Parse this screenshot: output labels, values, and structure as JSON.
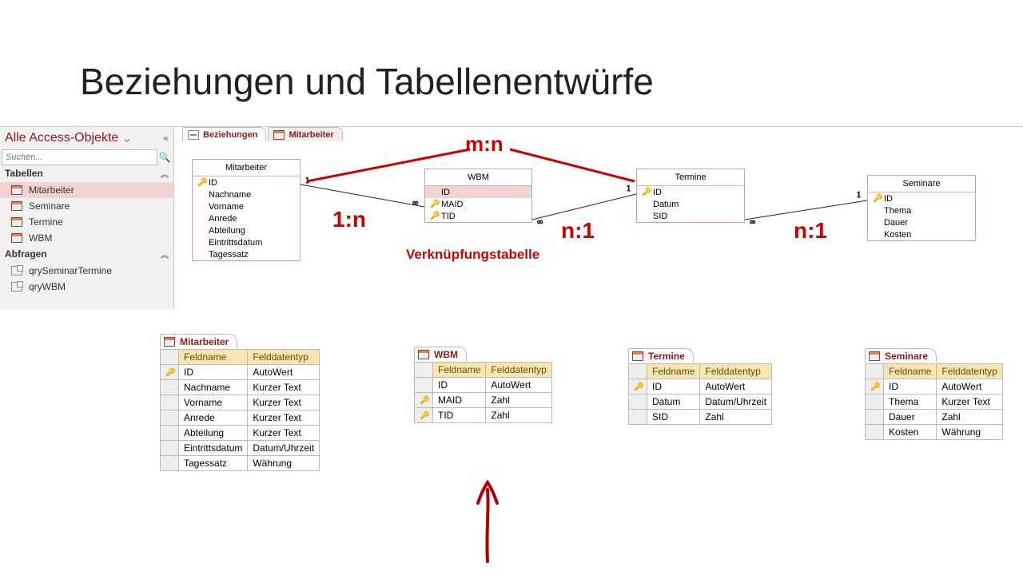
{
  "title": "Beziehungen und Tabellenentwürfe",
  "nav": {
    "header": "Alle Access-Objekte",
    "search_placeholder": "Suchen...",
    "group_tables": "Tabellen",
    "group_queries": "Abfragen",
    "tables": [
      "Mitarbeiter",
      "Seminare",
      "Termine",
      "WBM"
    ],
    "queries": [
      "qrySeminarTermine",
      "qryWBM"
    ]
  },
  "tabs": {
    "t1": "Beziehungen",
    "t2": "Mitarbeiter"
  },
  "annotations": {
    "mn": "m:n",
    "r1": "1:n",
    "r2": "n:1",
    "r3": "n:1",
    "junction": "Verknüpfungstabelle"
  },
  "entities": {
    "mitarbeiter": {
      "title": "Mitarbeiter",
      "fields": [
        "ID",
        "Nachname",
        "Vorname",
        "Anrede",
        "Abteilung",
        "Eintrittsdatum",
        "Tagessatz"
      ]
    },
    "wbm": {
      "title": "WBM",
      "fields": [
        "ID",
        "MAID",
        "TID"
      ]
    },
    "termine": {
      "title": "Termine",
      "fields": [
        "ID",
        "Datum",
        "SID"
      ]
    },
    "seminare": {
      "title": "Seminare",
      "fields": [
        "ID",
        "Thema",
        "Dauer",
        "Kosten"
      ]
    }
  },
  "designs": {
    "col_name": "Feldname",
    "col_type": "Felddatentyp",
    "mitarbeiter": {
      "tab": "Mitarbeiter",
      "rows": [
        {
          "k": true,
          "n": "ID",
          "t": "AutoWert"
        },
        {
          "k": false,
          "n": "Nachname",
          "t": "Kurzer Text"
        },
        {
          "k": false,
          "n": "Vorname",
          "t": "Kurzer Text"
        },
        {
          "k": false,
          "n": "Anrede",
          "t": "Kurzer Text"
        },
        {
          "k": false,
          "n": "Abteilung",
          "t": "Kurzer Text"
        },
        {
          "k": false,
          "n": "Eintrittsdatum",
          "t": "Datum/Uhrzeit"
        },
        {
          "k": false,
          "n": "Tagessatz",
          "t": "Währung"
        }
      ]
    },
    "wbm": {
      "tab": "WBM",
      "rows": [
        {
          "k": false,
          "n": "ID",
          "t": "AutoWert"
        },
        {
          "k": true,
          "n": "MAID",
          "t": "Zahl"
        },
        {
          "k": true,
          "n": "TID",
          "t": "Zahl"
        }
      ]
    },
    "termine": {
      "tab": "Termine",
      "rows": [
        {
          "k": true,
          "n": "ID",
          "t": "AutoWert"
        },
        {
          "k": false,
          "n": "Datum",
          "t": "Datum/Uhrzeit"
        },
        {
          "k": false,
          "n": "SID",
          "t": "Zahl"
        }
      ]
    },
    "seminare": {
      "tab": "Seminare",
      "rows": [
        {
          "k": true,
          "n": "ID",
          "t": "AutoWert"
        },
        {
          "k": false,
          "n": "Thema",
          "t": "Kurzer Text"
        },
        {
          "k": false,
          "n": "Dauer",
          "t": "Zahl"
        },
        {
          "k": false,
          "n": "Kosten",
          "t": "Währung"
        }
      ]
    }
  }
}
